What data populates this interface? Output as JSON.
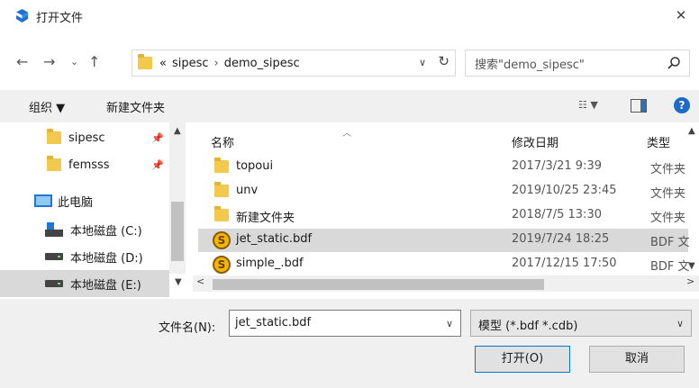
{
  "window": {
    "title": "打开文件"
  },
  "address": {
    "prefix": "«",
    "crumbs": [
      "sipesc",
      "demo_sipesc"
    ],
    "separator": "›",
    "search_placeholder": "搜索\"demo_sipesc\""
  },
  "toolbar": {
    "organize": "组织 ▼",
    "new_folder": "新建文件夹"
  },
  "nav": {
    "items": [
      {
        "label": "sipesc",
        "pinned": true
      },
      {
        "label": "femsss",
        "pinned": true
      },
      {
        "label": "此电脑"
      },
      {
        "label": "本地磁盘 (C:)"
      },
      {
        "label": "本地磁盘 (D:)"
      },
      {
        "label": "本地磁盘 (E:)",
        "selected": true
      }
    ]
  },
  "columns": {
    "name": "名称",
    "date": "修改日期",
    "type": "类型"
  },
  "files": [
    {
      "name": "topoui",
      "date": "2017/3/21 9:39",
      "type": "文件夹",
      "icon": "folder"
    },
    {
      "name": "unv",
      "date": "2019/10/25 23:45",
      "type": "文件夹",
      "icon": "folder"
    },
    {
      "name": "新建文件夹",
      "date": "2018/7/5 13:30",
      "type": "文件夹",
      "icon": "folder"
    },
    {
      "name": "jet_static.bdf",
      "date": "2019/7/24 18:25",
      "type": "BDF 文",
      "icon": "bdf",
      "selected": true
    },
    {
      "name": "simple_.bdf",
      "date": "2017/12/15 17:50",
      "type": "BDF 文",
      "icon": "bdf"
    }
  ],
  "bottom": {
    "filename_label": "文件名(N):",
    "filename_value": "jet_static.bdf",
    "filetype_value": "模型 (*.bdf *.cdb)",
    "open_label": "打开(O)",
    "cancel_label": "取消"
  },
  "colors": {
    "accent": "#0078d7",
    "selection": "#d9d9d9",
    "folder": "#f2c94c"
  }
}
